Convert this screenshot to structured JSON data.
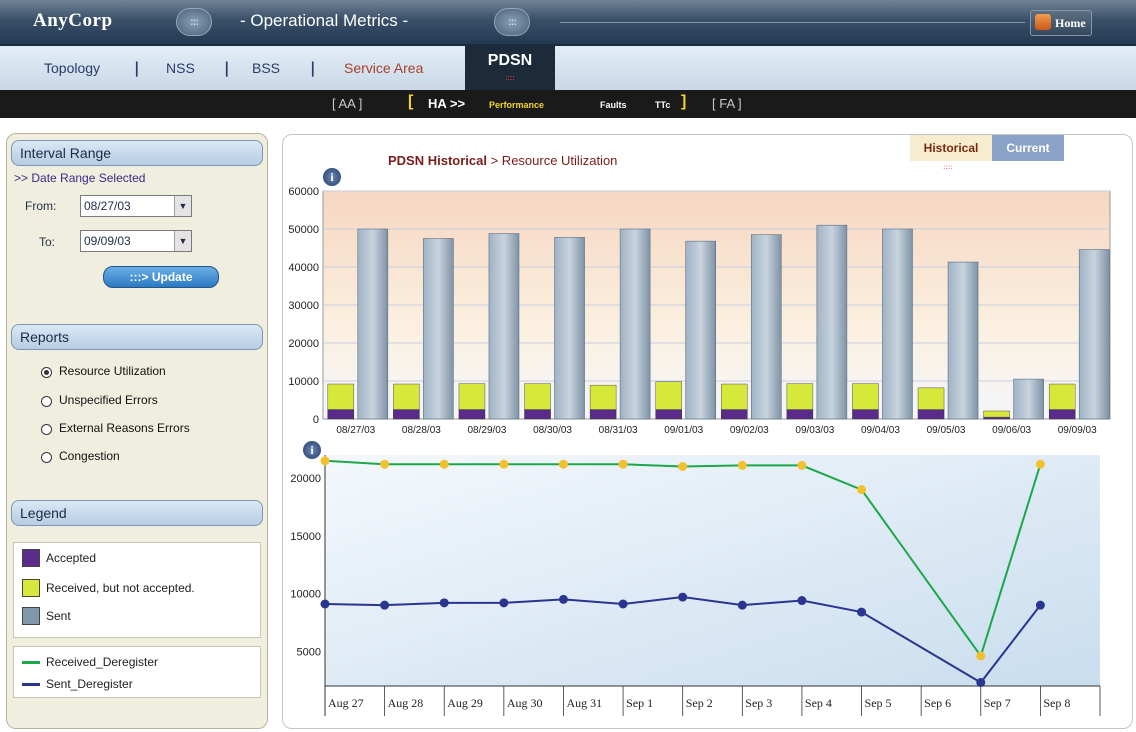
{
  "header": {
    "brand": "AnyCorp",
    "title": "- Operational Metrics -",
    "orb": ":::",
    "home_label": "Home"
  },
  "nav": {
    "tabs": [
      "Topology",
      "NSS",
      "BSS",
      "Service Area",
      "PDSN"
    ],
    "active": "PDSN",
    "active_dots": "::::"
  },
  "subnav": {
    "aa": "[ AA ]",
    "ha": "HA >>",
    "performance": "Performance",
    "faults": "Faults",
    "ttc": "TTc",
    "fa": "[ FA ]"
  },
  "interval": {
    "heading": "Interval Range",
    "subtitle": ">> Date Range Selected",
    "from_label": "From:",
    "from_value": "08/27/03",
    "to_label": "To:",
    "to_value": "09/09/03",
    "update_label": ":::> Update"
  },
  "reports": {
    "heading": "Reports",
    "items": [
      "Resource Utilization",
      "Unspecified Errors",
      "External Reasons Errors",
      "Congestion"
    ],
    "selected": "Resource Utilization"
  },
  "legend": {
    "heading": "Legend",
    "bars": [
      {
        "label": "Accepted",
        "color": "#5a2b8a"
      },
      {
        "label": "Received, but not accepted.",
        "color": "#d6e83a"
      },
      {
        "label": "Sent",
        "color": "#8098ac"
      }
    ],
    "lines": [
      {
        "label": "Received_Deregister",
        "color": "#1aa84a"
      },
      {
        "label": "Sent_Deregister",
        "color": "#2a3590"
      }
    ]
  },
  "main": {
    "title": "PDSN Historical",
    "crumb": " > Resource Utilization",
    "toggle_historical": "Historical",
    "toggle_current": "Current",
    "hist_dots": "::::",
    "info": "i"
  },
  "chart_data": [
    {
      "type": "bar",
      "stacked_plus_grouped": true,
      "categories": [
        "08/27/03",
        "08/28/03",
        "08/29/03",
        "08/30/03",
        "08/31/03",
        "09/01/03",
        "09/02/03",
        "09/03/03",
        "09/04/03",
        "09/05/03",
        "09/06/03",
        "09/09/03"
      ],
      "series": [
        {
          "name": "Accepted",
          "color": "#5a2b8a",
          "values": [
            2500,
            2500,
            2500,
            2500,
            2500,
            2500,
            2500,
            2500,
            2500,
            2500,
            500,
            2500
          ]
        },
        {
          "name": "Received, but not accepted.",
          "color": "#d6e83a",
          "values": [
            6700,
            6700,
            6800,
            6800,
            6400,
            7300,
            6700,
            6800,
            6800,
            5700,
            1600,
            6700
          ]
        },
        {
          "name": "Sent",
          "color": "#8098ac",
          "values": [
            50000,
            47500,
            48800,
            47800,
            50000,
            46800,
            48500,
            51000,
            50000,
            41300,
            10500,
            44600
          ]
        }
      ],
      "yticks": [
        0,
        10000,
        20000,
        30000,
        40000,
        50000,
        60000
      ],
      "ylim": [
        0,
        60000
      ],
      "grid": true
    },
    {
      "type": "line",
      "x": [
        "Aug 27",
        "Aug 28",
        "Aug 29",
        "Aug 30",
        "Aug 31",
        "Sep 1",
        "Sep 2",
        "Sep 3",
        "Sep 4",
        "Sep 5",
        "Sep 6",
        "Sep 7",
        "Sep 8"
      ],
      "series": [
        {
          "name": "Received_Deregister",
          "color": "#1aa84a",
          "marker_color": "#f2c12e",
          "points": [
            [
              "Aug 27",
              21500
            ],
            [
              "Aug 28",
              21200
            ],
            [
              "Aug 29",
              21200
            ],
            [
              "Aug 30",
              21200
            ],
            [
              "Aug 31",
              21200
            ],
            [
              "Sep 1",
              21200
            ],
            [
              "Sep 2",
              21000
            ],
            [
              "Sep 3",
              21100
            ],
            [
              "Sep 4",
              21100
            ],
            [
              "Sep 5",
              19000
            ],
            [
              "Sep 7",
              4600
            ],
            [
              "Sep 8",
              21200
            ]
          ]
        },
        {
          "name": "Sent_Deregister",
          "color": "#2a3590",
          "marker_color": "#2a3590",
          "points": [
            [
              "Aug 27",
              9100
            ],
            [
              "Aug 28",
              9000
            ],
            [
              "Aug 29",
              9200
            ],
            [
              "Aug 30",
              9200
            ],
            [
              "Aug 31",
              9500
            ],
            [
              "Sep 1",
              9100
            ],
            [
              "Sep 2",
              9700
            ],
            [
              "Sep 3",
              9000
            ],
            [
              "Sep 4",
              9400
            ],
            [
              "Sep 5",
              8400
            ],
            [
              "Sep 7",
              2300
            ],
            [
              "Sep 8",
              9000
            ]
          ]
        }
      ],
      "yticks": [
        5000,
        10000,
        15000,
        20000
      ],
      "ylim": [
        2000,
        22000
      ]
    }
  ]
}
